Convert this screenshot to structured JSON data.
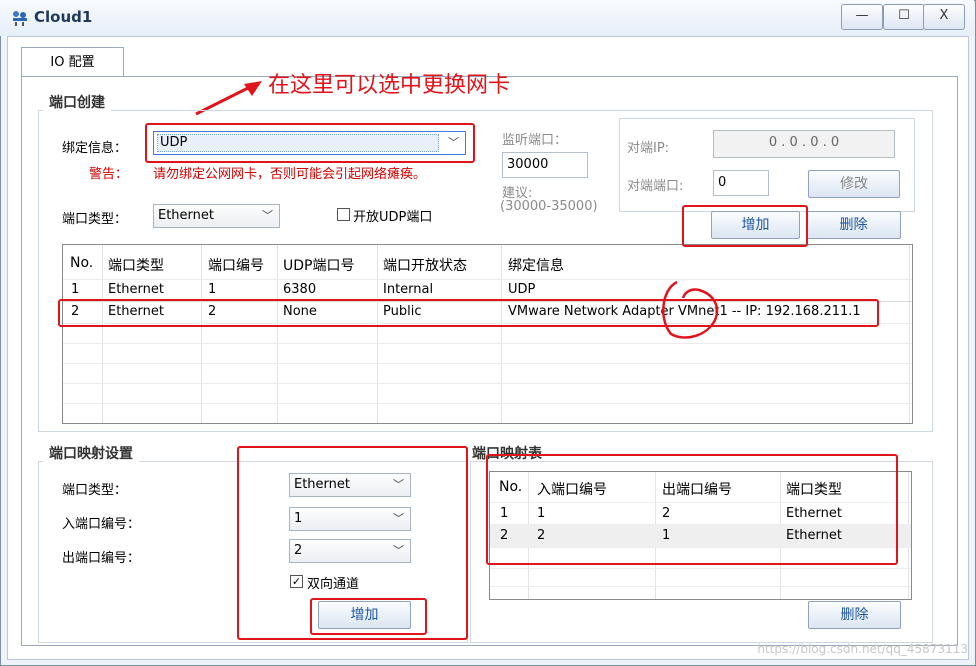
{
  "window": {
    "title": "Cloud1",
    "minimize": "—",
    "maximize": "☐",
    "close": "X"
  },
  "tabs": [
    {
      "label": "IO 配置"
    }
  ],
  "annotation": {
    "text": "在这里可以选中更换网卡"
  },
  "port_create": {
    "title": "端口创建",
    "bind_label": "绑定信息：",
    "bind_value": "UDP",
    "warning_label": "警告：",
    "warning_text": "请勿绑定公网网卡，否则可能会引起网络瘫痪。",
    "port_type_label": "端口类型：",
    "port_type_value": "Ethernet",
    "open_udp_label": "开放UDP端口",
    "listen_port_label": "监听端口：",
    "listen_port_value": "30000",
    "suggest_label": "建议:",
    "suggest_range": "(30000-35000)",
    "peer_ip_label": "对端IP:",
    "peer_ip_value": "0  .  0  .  0  .  0",
    "peer_port_label": "对端端口:",
    "peer_port_value": "0",
    "modify_label": "修改",
    "add_label": "增加",
    "delete_label": "删除",
    "columns": [
      "No.",
      "端口类型",
      "端口编号",
      "UDP端口号",
      "端口开放状态",
      "绑定信息"
    ],
    "rows": [
      [
        "1",
        "Ethernet",
        "1",
        "6380",
        "Internal",
        "UDP"
      ],
      [
        "2",
        "Ethernet",
        "2",
        "None",
        "Public",
        "VMware Network Adapter VMnet1 -- IP: 192.168.211.1"
      ]
    ]
  },
  "port_map_settings": {
    "title": "端口映射设置",
    "port_type_label": "端口类型：",
    "port_type_value": "Ethernet",
    "in_port_label": "入端口编号：",
    "in_port_value": "1",
    "out_port_label": "出端口编号：",
    "out_port_value": "2",
    "bidirectional_label": "双向通道",
    "add_label": "增加"
  },
  "port_map_table": {
    "title": "端口映射表",
    "columns": [
      "No.",
      "入端口编号",
      "出端口编号",
      "端口类型"
    ],
    "rows": [
      [
        "1",
        "1",
        "2",
        "Ethernet"
      ],
      [
        "2",
        "2",
        "1",
        "Ethernet"
      ]
    ],
    "delete_label": "删除"
  },
  "watermark": "https://blog.csdn.net/qq_45873113"
}
